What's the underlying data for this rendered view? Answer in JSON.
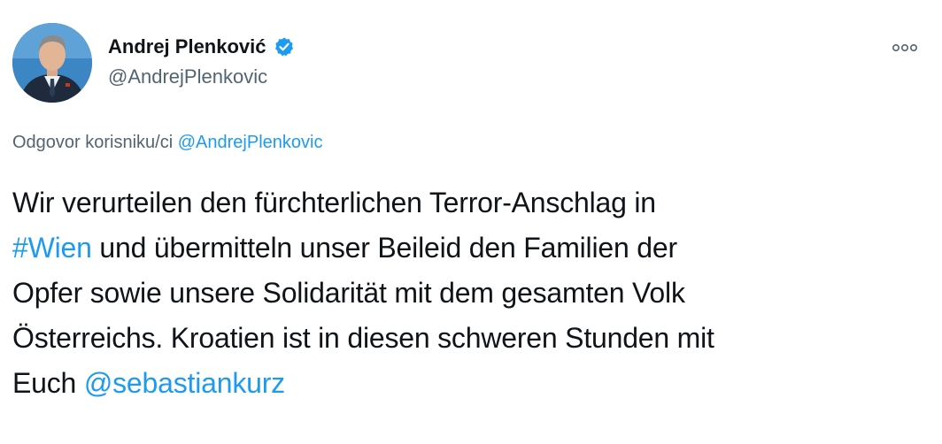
{
  "author": {
    "display_name": "Andrej Plenković",
    "handle": "@AndrejPlenkovic",
    "verified": true,
    "avatar_icon": "profile-photo"
  },
  "reply_context": {
    "prefix": "Odgovor korisniku/ci",
    "mention": "@AndrejPlenkovic"
  },
  "tweet": {
    "line1": "Wir verurteilen den fürchterlichen Terror-Anschlag in",
    "hashtag": "#Wien",
    "line2_rest": " und übermitteln unser Beileid den Familien der",
    "line3": "Opfer sowie unsere Solidarität mit dem gesamten Volk",
    "line4": "Österreichs. Kroatien ist in diesen schweren Stunden mit",
    "line5_prefix": "Euch ",
    "mention": "@sebastiankurz"
  },
  "colors": {
    "link": "#1d9bf0",
    "verified_badge": "#1d9bf0",
    "secondary_text": "#536471",
    "primary_text": "#0f1419"
  },
  "icons": {
    "more": "more-horizontal-icon",
    "verified": "verified-badge-icon"
  }
}
